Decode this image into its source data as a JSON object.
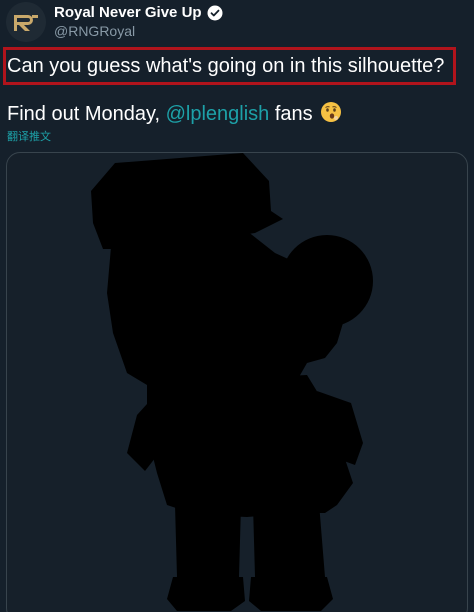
{
  "tweet": {
    "author": {
      "display_name": "Royal Never Give Up",
      "handle": "@RNGRoyal",
      "verified": true,
      "avatar_icon": "rng-logo-icon"
    },
    "text_line1": "Can you guess what's going on in this silhouette?",
    "text_line2_prefix": "Find out Monday, ",
    "text_line2_mention": "@lplenglish",
    "text_line2_suffix": " fans ",
    "emoji_icon": "hushed-face-emoji-icon",
    "translate_label": "翻译推文"
  },
  "colors": {
    "background": "#15202b",
    "highlight_border": "#b1141c",
    "link": "#1da1a8",
    "muted": "#8899a6"
  }
}
